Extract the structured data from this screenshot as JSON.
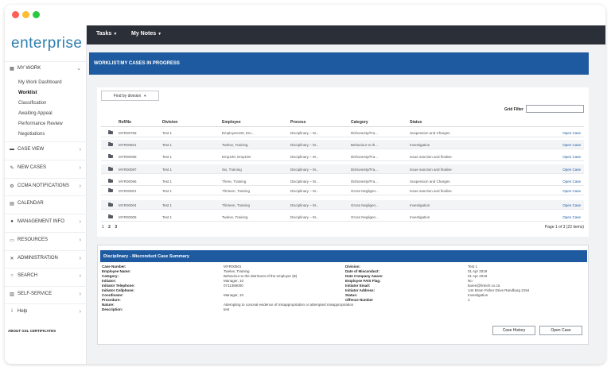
{
  "app": {
    "logo": "enterprise"
  },
  "sidebar": {
    "groups": [
      {
        "label": "MY WORK",
        "icon": "grid-icon",
        "chevron": "⌄"
      },
      {
        "label": "CASE VIEW",
        "icon": "folder-icon",
        "chevron": "›"
      },
      {
        "label": "NEW CASES",
        "icon": "edit-icon",
        "chevron": "›"
      },
      {
        "label": "CCMA NOTIFICATIONS",
        "icon": "gear-icon",
        "chevron": "›"
      },
      {
        "label": "CALENDAR",
        "icon": "calendar-icon",
        "chevron": ""
      },
      {
        "label": "MANAGEMENT INFO",
        "icon": "person-icon",
        "chevron": "›"
      },
      {
        "label": "RESOURCES",
        "icon": "folder-open-icon",
        "chevron": "›"
      },
      {
        "label": "ADMINISTRATION",
        "icon": "wrench-icon",
        "chevron": "›"
      },
      {
        "label": "SEARCH",
        "icon": "search-icon",
        "chevron": "›"
      },
      {
        "label": "SELF-SERVICE",
        "icon": "keyboard-icon",
        "chevron": "›"
      },
      {
        "label": "Help",
        "icon": "info-icon",
        "chevron": "›"
      }
    ],
    "my_work_items": [
      {
        "label": "My Work Dashboard"
      },
      {
        "label": "Worklist"
      },
      {
        "label": "Classification"
      },
      {
        "label": "Awaiting Appeal"
      },
      {
        "label": "Performance Review"
      },
      {
        "label": "Negotiations"
      }
    ],
    "footer": "ABOUT GSL CERTIFICATES"
  },
  "topbar": {
    "menus": [
      {
        "label": "Tasks",
        "caret": "▼"
      },
      {
        "label": "My Notes",
        "caret": "▼"
      }
    ]
  },
  "banner": {
    "title": "WORKLIST:MY CASES IN PROGRESS"
  },
  "worklist": {
    "filter_button": "Find by division",
    "filter_caret": "▼",
    "grid_filter_label": "Grid Filter",
    "columns": [
      "Ref/No",
      "Division",
      "Employee",
      "Process",
      "Category",
      "Status"
    ],
    "open_label": "Open Case",
    "rows": [
      {
        "ref": "MYR00768",
        "division": "Test 1",
        "employee": "Employee100, Em...",
        "process": "Disciplinary – M...",
        "category": "Dishonesty/Fra...",
        "status": "Suspension and Charges"
      },
      {
        "ref": "MYR00601",
        "division": "Test 1",
        "employee": "Twelve, Training",
        "process": "Disciplinary – M...",
        "category": "Behaviour to th...",
        "status": "Investigation"
      },
      {
        "ref": "MYR00099",
        "division": "Test 1",
        "employee": "Emp100, Emp100",
        "process": "Disciplinary – M...",
        "category": "Dishonesty/Fra...",
        "status": "Issue sanction and finalise"
      },
      {
        "ref": "MYR00087",
        "division": "Test 1",
        "employee": "Six, Training",
        "process": "Disciplinary – M...",
        "category": "Dishonesty/Fra...",
        "status": "Issue sanction and finalise"
      },
      {
        "ref": "MYR00086",
        "division": "Test 1",
        "employee": "Three, Training",
        "process": "Disciplinary – M...",
        "category": "Dishonesty/Fra...",
        "status": "Suspension and Charges"
      },
      {
        "ref": "MYR00001",
        "division": "Test 1",
        "employee": "Thirteen, Training",
        "process": "Disciplinary – M...",
        "category": "Gross Negligen...",
        "status": "Issue sanction and finalise"
      },
      {
        "ref": "MYR00004",
        "division": "Test 1",
        "employee": "Thirteen, Training",
        "process": "Disciplinary – M...",
        "category": "Gross Negligen...",
        "status": "Investigation"
      },
      {
        "ref": "MYR00005",
        "division": "Test 1",
        "employee": "Twelve, Training",
        "process": "Disciplinary – M...",
        "category": "Gross Negligen...",
        "status": "Investigation"
      }
    ],
    "pages": [
      "1",
      "2",
      "3"
    ],
    "page_info": "Page 1 of 3 (22 items)"
  },
  "summary": {
    "title": "Disciplinary - Misconduct Case Summary",
    "left_fields": [
      {
        "label": "Case Number:",
        "value": "MYR00601"
      },
      {
        "label": "Employee Name:",
        "value": "Twelve, Training"
      },
      {
        "label": "Category:",
        "value": "Behaviour to the detriment of the employer (B)"
      },
      {
        "label": "Initiator:",
        "value": "Manager, 10"
      },
      {
        "label": "Initiator Telephone:",
        "value": "0711389000"
      },
      {
        "label": "Initiator Cellphone:",
        "value": ""
      },
      {
        "label": "Coordinator:",
        "value": "Manager, 10"
      },
      {
        "label": "Procedure:",
        "value": ""
      },
      {
        "label": "Nature:",
        "value": "Attempting to conceal evidence of misappropriation or attempted misappropriation"
      },
      {
        "label": "Description:",
        "value": "test"
      }
    ],
    "right_fields": [
      {
        "label": "Division:",
        "value": "Test 1"
      },
      {
        "label": "Date of Misconduct:",
        "value": "01 Apr 2019"
      },
      {
        "label": "Date Company Aware:",
        "value": "01 Apr 2019"
      },
      {
        "label": "Employee FAIS Flag:",
        "value": "No"
      },
      {
        "label": "Initiator Email:",
        "value": "karen@hrtech.co.za"
      },
      {
        "label": "Initiator Address:",
        "value": "144 Bram Fisher Drive Randburg 2194"
      },
      {
        "label": "Status:",
        "value": "Investigation"
      },
      {
        "label": "Offence Number",
        "value": "1"
      }
    ],
    "buttons": {
      "history": "Case History",
      "open": "Open Case"
    }
  }
}
